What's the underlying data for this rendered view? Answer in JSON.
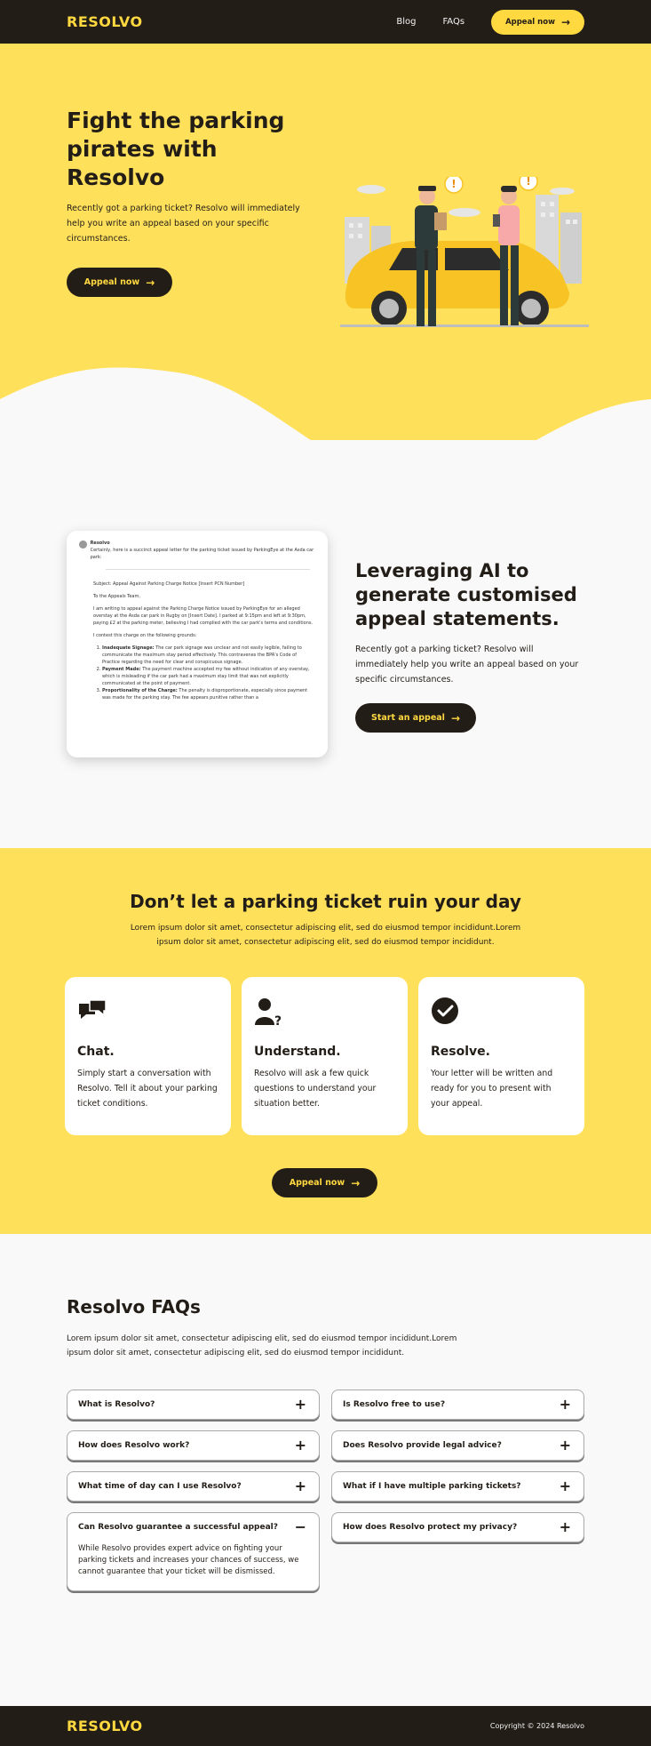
{
  "nav": {
    "logo": "RESOLVO",
    "links": [
      "Blog",
      "FAQs"
    ],
    "cta": "Appeal now"
  },
  "hero": {
    "title": "Fight the parking pirates with Resolvo",
    "text": "Recently got a parking ticket? Resolvo will immediately help you write an appeal based on your specific circumstances.",
    "cta": "Appeal now"
  },
  "ai_section": {
    "title": "Leveraging AI to generate customised appeal statements.",
    "text": "Recently got a parking ticket? Resolvo will immediately help you write an appeal based on your specific circumstances.",
    "cta": "Start an appeal",
    "screenshot": {
      "sender": "Resolvo",
      "intro": "Certainly, here is a succinct appeal letter for the parking ticket issued by ParkingEye at the Asda car park:",
      "subject": "Subject: Appeal Against Parking Charge Notice [Insert PCN Number]",
      "greeting": "To the Appeals Team,",
      "para1": "I am writing to appeal against the Parking Charge Notice issued by ParkingEye for an alleged overstay at the Asda car park in Rugby on [Insert Date]. I parked at 9:15pm and left at 9:30pm, paying £2 at the parking meter, believing I had complied with the car park's terms and conditions.",
      "para2": "I contest this charge on the following grounds:",
      "points": [
        {
          "label": "Inadequate Signage:",
          "text": "The car park signage was unclear and not easily legible, failing to communicate the maximum stay period effectively. This contravenes the BPA's Code of Practice regarding the need for clear and conspicuous signage."
        },
        {
          "label": "Payment Made:",
          "text": "The payment machine accepted my fee without indication of any overstay, which is misleading if the car park had a maximum stay limit that was not explicitly communicated at the point of payment."
        },
        {
          "label": "Proportionality of the Charge:",
          "text": "The penalty is disproportionate, especially since payment was made for the parking stay. The fee appears punitive rather than a"
        }
      ]
    }
  },
  "features": {
    "title": "Don’t let a parking ticket ruin your day",
    "subtitle": "Lorem ipsum dolor sit amet, consectetur adipiscing elit, sed do eiusmod tempor incididunt.Lorem ipsum dolor sit amet, consectetur adipiscing elit, sed do eiusmod tempor incididunt.",
    "cards": [
      {
        "icon": "chat-bubbles-icon",
        "title": "Chat.",
        "text": "Simply start a conversation with Resolvo. Tell it about your parking ticket conditions."
      },
      {
        "icon": "user-question-icon",
        "title": "Understand.",
        "text": "Resolvo will ask a few quick questions to understand your situation better."
      },
      {
        "icon": "check-circle-icon",
        "title": "Resolve.",
        "text": "Your letter will be written and ready for you to present with your appeal."
      }
    ],
    "cta": "Appeal now"
  },
  "faq": {
    "title": "Resolvo FAQs",
    "subtitle": "Lorem ipsum dolor sit amet, consectetur adipiscing elit, sed do eiusmod tempor incididunt.Lorem ipsum dolor sit amet, consectetur adipiscing elit, sed do eiusmod tempor incididunt.",
    "left": [
      {
        "q": "What is Resolvo?",
        "sign": "+"
      },
      {
        "q": "How does Resolvo work?",
        "sign": "+"
      },
      {
        "q": "What time of day can I use Resolvo?",
        "sign": "+"
      },
      {
        "q": "Can Resolvo guarantee a successful appeal?",
        "sign": "−",
        "a": "While Resolvo provides expert advice on fighting your parking tickets and increases your chances of success, we cannot guarantee that your ticket will be dismissed."
      }
    ],
    "right": [
      {
        "q": "Is Resolvo free to use?",
        "sign": "+"
      },
      {
        "q": "Does Resolvo provide legal advice?",
        "sign": "+"
      },
      {
        "q": "What if I have multiple parking tickets?",
        "sign": "+"
      },
      {
        "q": "How does Resolvo protect my privacy?",
        "sign": "+"
      }
    ]
  },
  "footer": {
    "logo": "RESOLVO",
    "copyright": "Copyright © 2024 Resolvo"
  },
  "colors": {
    "brand_yellow": "#ffd93f",
    "section_yellow": "#ffe05b",
    "dark": "#231d17"
  }
}
